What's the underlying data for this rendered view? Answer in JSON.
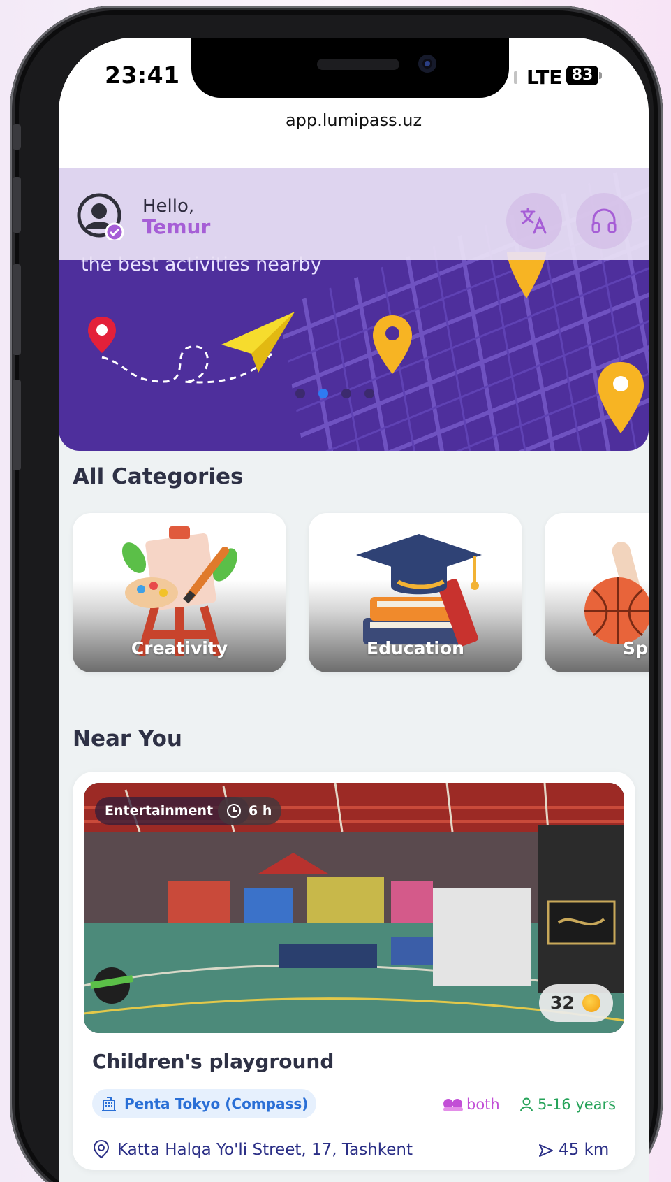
{
  "status_bar": {
    "time": "23:41",
    "network": "LTE",
    "battery": "83"
  },
  "browser": {
    "url": "app.lumipass.uz"
  },
  "header": {
    "greeting": "Hello,",
    "user_name": "Temur"
  },
  "banner": {
    "subtitle": "the best activities nearby",
    "slide_count": 4,
    "active_slide": 2
  },
  "categories": {
    "title": "All Categories",
    "items": [
      {
        "label": "Creativity"
      },
      {
        "label": "Education"
      },
      {
        "label": "Sp"
      }
    ]
  },
  "near_you": {
    "title": "Near You",
    "card": {
      "category": "Entertainment",
      "duration": "6 h",
      "points": "32",
      "title": "Children's playground",
      "place": "Penta Tokyo (Compass)",
      "gender": "both",
      "age": "5-16 years",
      "address": "Katta Halqa Yo'li Street, 17, Tashkent",
      "distance": "45 km"
    }
  },
  "colors": {
    "accent": "#a65ed6",
    "banner": "#4e2f9c",
    "brand_blue": "#2a6fd6",
    "age_green": "#27a35a"
  }
}
